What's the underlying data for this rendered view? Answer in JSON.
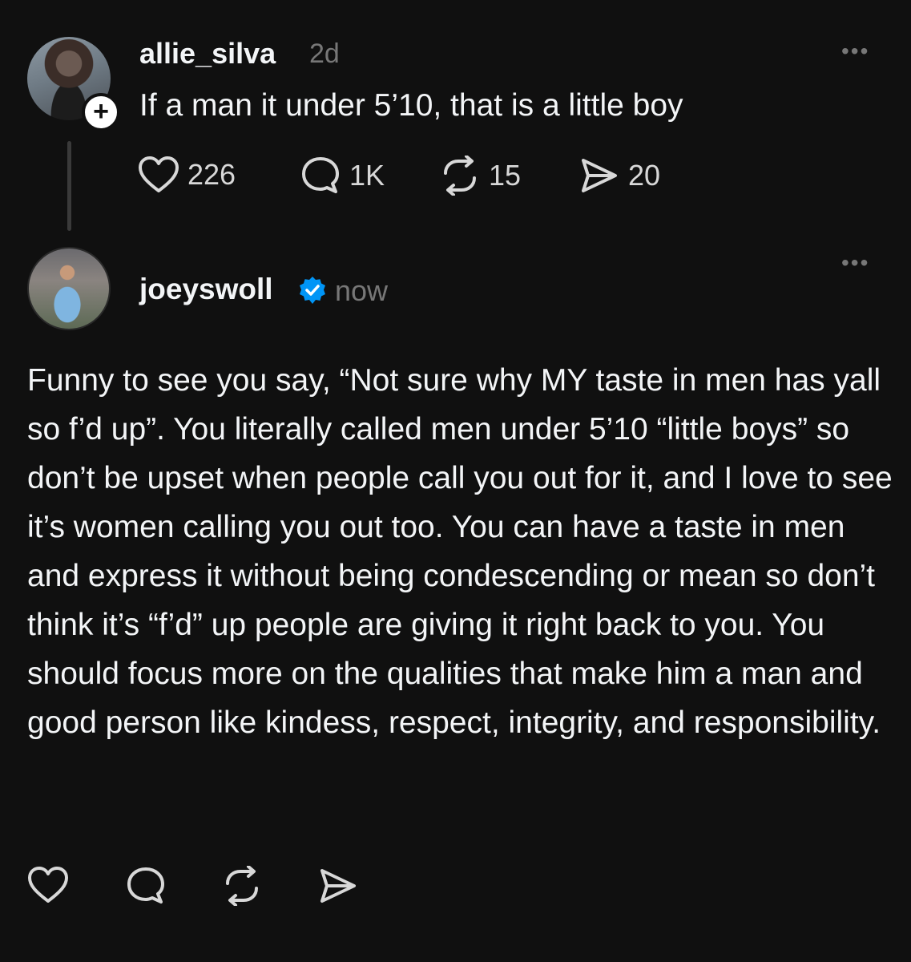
{
  "post1": {
    "username": "allie_silva",
    "time": "2d",
    "more": "•••",
    "text": "If a man it under 5’10, that is a little boy",
    "follow_icon": "+",
    "likes": "226",
    "replies": "1K",
    "reposts": "15",
    "shares": "20"
  },
  "post2": {
    "username": "joeyswoll",
    "verified": true,
    "time": "now",
    "more": "•••",
    "text": "Funny to see you say, “Not sure why MY taste in men has yall so f’d up”. You literally called men under 5’10 “little boys” so don’t be upset when people call you out for it, and I love to see it’s women calling you out too. You can have a taste in men and express it without being condescending or mean so don’t think it’s “f’d” up people are giving it right back to you. You should focus more on the qualities that make him a man and good person like kindess, respect, integrity, and responsibility."
  },
  "colors": {
    "background": "#101010",
    "text": "#f3f5f7",
    "muted": "#777777",
    "verified": "#0095f6"
  },
  "icons": [
    "heart-icon",
    "comment-icon",
    "repost-icon",
    "share-icon",
    "more-icon",
    "verified-icon",
    "follow-plus-icon"
  ]
}
